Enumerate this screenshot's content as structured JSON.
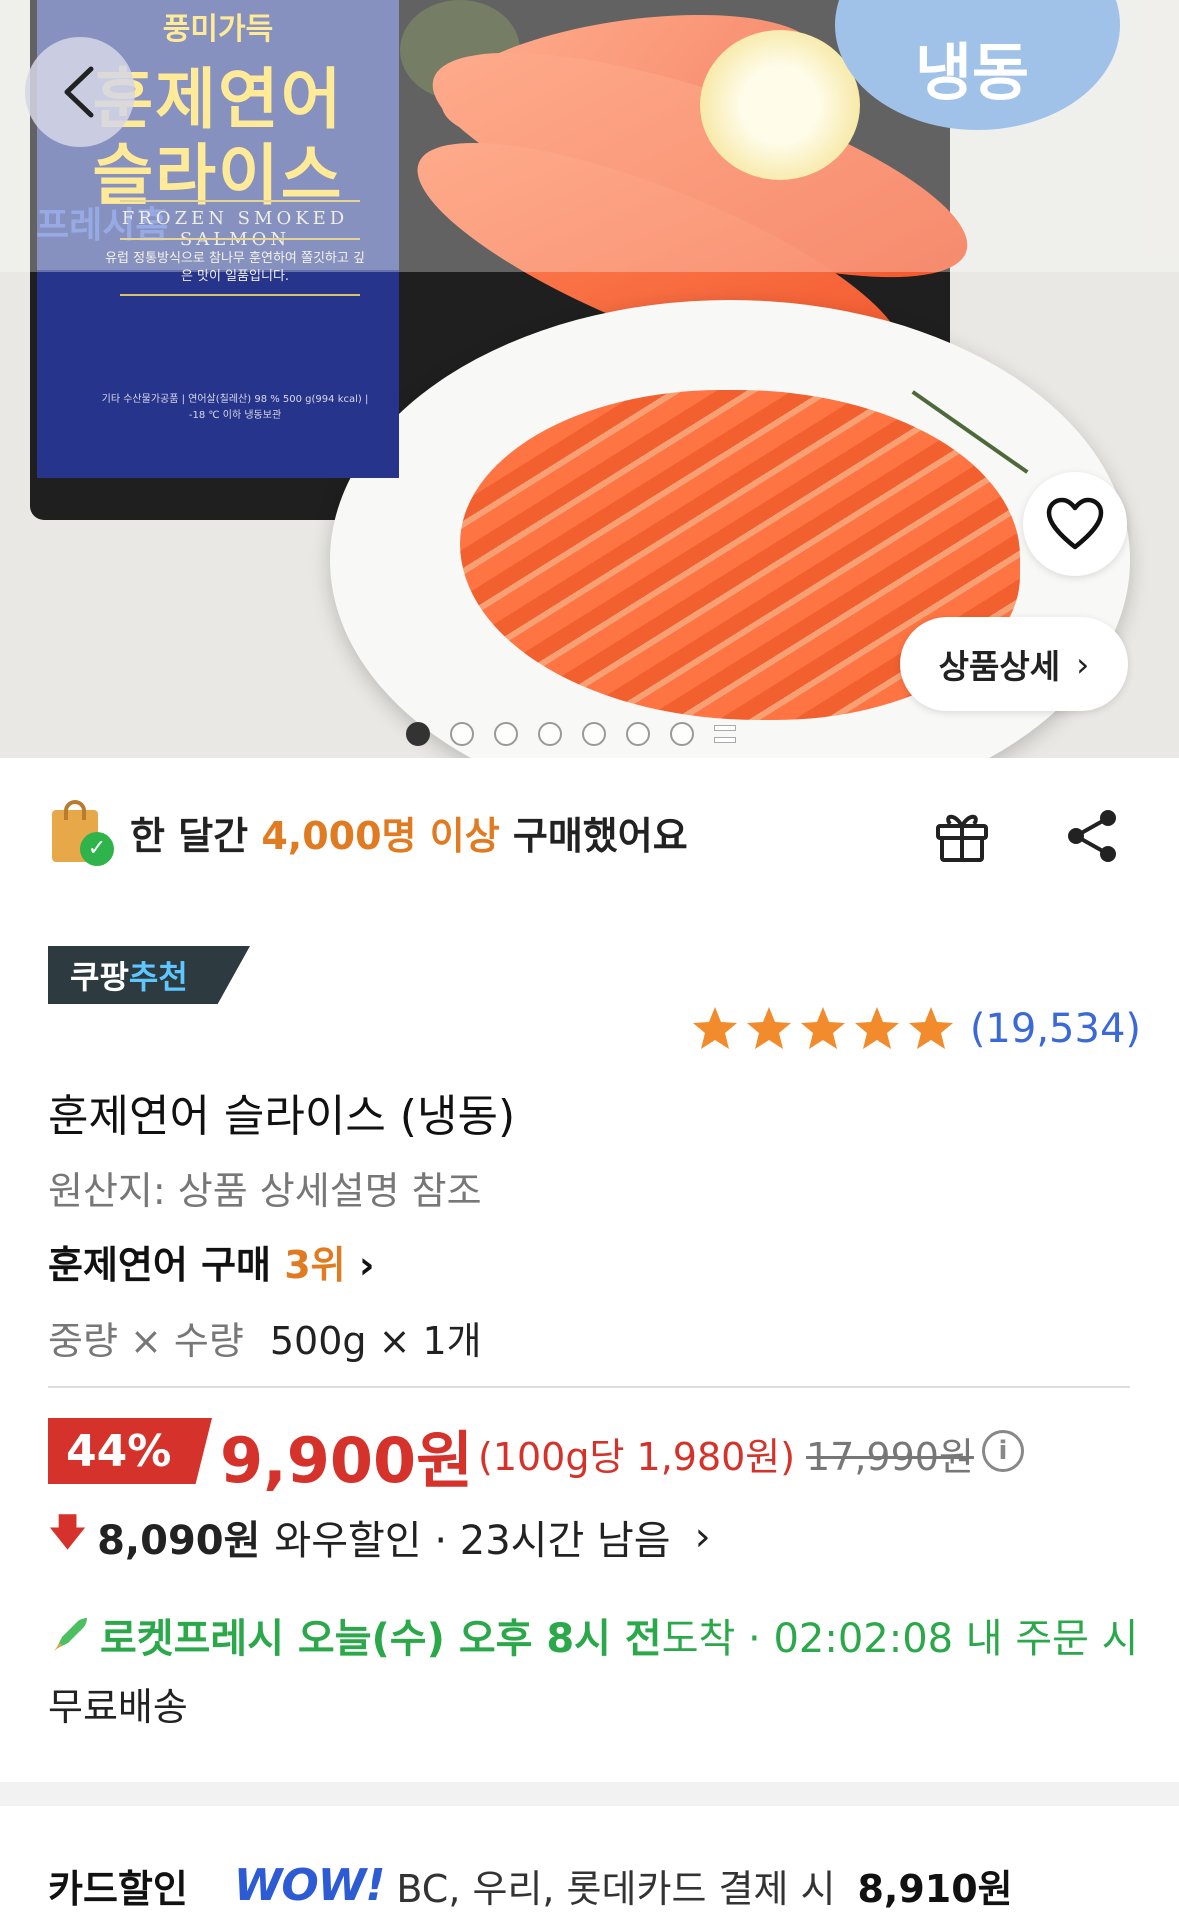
{
  "hero": {
    "pack_brand": "풍미가득",
    "pack_title_line1": "훈제연어",
    "pack_title_line2": "슬라이스",
    "pack_subtitle": "FROZEN SMOKED SALMON",
    "pack_description": "유럽 정통방식으로 참나무 훈연하여 쫄깃하고 깊은 맛이 일품입니다.",
    "pack_info": "기타 수산물가공품 | 연어살(칠레산) 98 % 500 g(994 kcal) | -18 ℃ 이하 냉동보관",
    "pack_fresh": "프레시홈",
    "frozen_badge": "냉동",
    "detail_button": "상품상세",
    "dots_total": 7,
    "dots_active": 0
  },
  "buyers": {
    "prefix": "한 달간 ",
    "highlight": "4,000명 이상",
    "suffix": " 구매했어요"
  },
  "badge": {
    "part1": "쿠팡",
    "part2": "추천"
  },
  "rating": {
    "stars": 5,
    "count": "(19,534)",
    "star_color": "#f28b2c"
  },
  "product": {
    "title": "훈제연어 슬라이스 (냉동)",
    "origin": "원산지: 상품 상세설명 참조",
    "rank_label": "훈제연어 구매 ",
    "rank_value": "3위",
    "weight_label": "중량 × 수량",
    "weight_value": "500g × 1개"
  },
  "price": {
    "discount": "44%",
    "sale": "9,900원",
    "unit": "(100g당 1,980원)",
    "original": "17,990원",
    "accent_color": "#d5322b"
  },
  "wow": {
    "amount": "8,090원",
    "text": "와우할인 · 23시간 남음"
  },
  "delivery": {
    "bold_text": "로켓프레시 오늘(수) 오후 8시 전",
    "rest": " 도착 · 02:02:08 내 주문 시",
    "free": "무료배송",
    "color": "#2aa84a"
  },
  "card": {
    "label": "카드할인",
    "logo": "WOW!",
    "text": "BC, 우리, 롯데카드 결제 시",
    "amount": "8,910원"
  }
}
